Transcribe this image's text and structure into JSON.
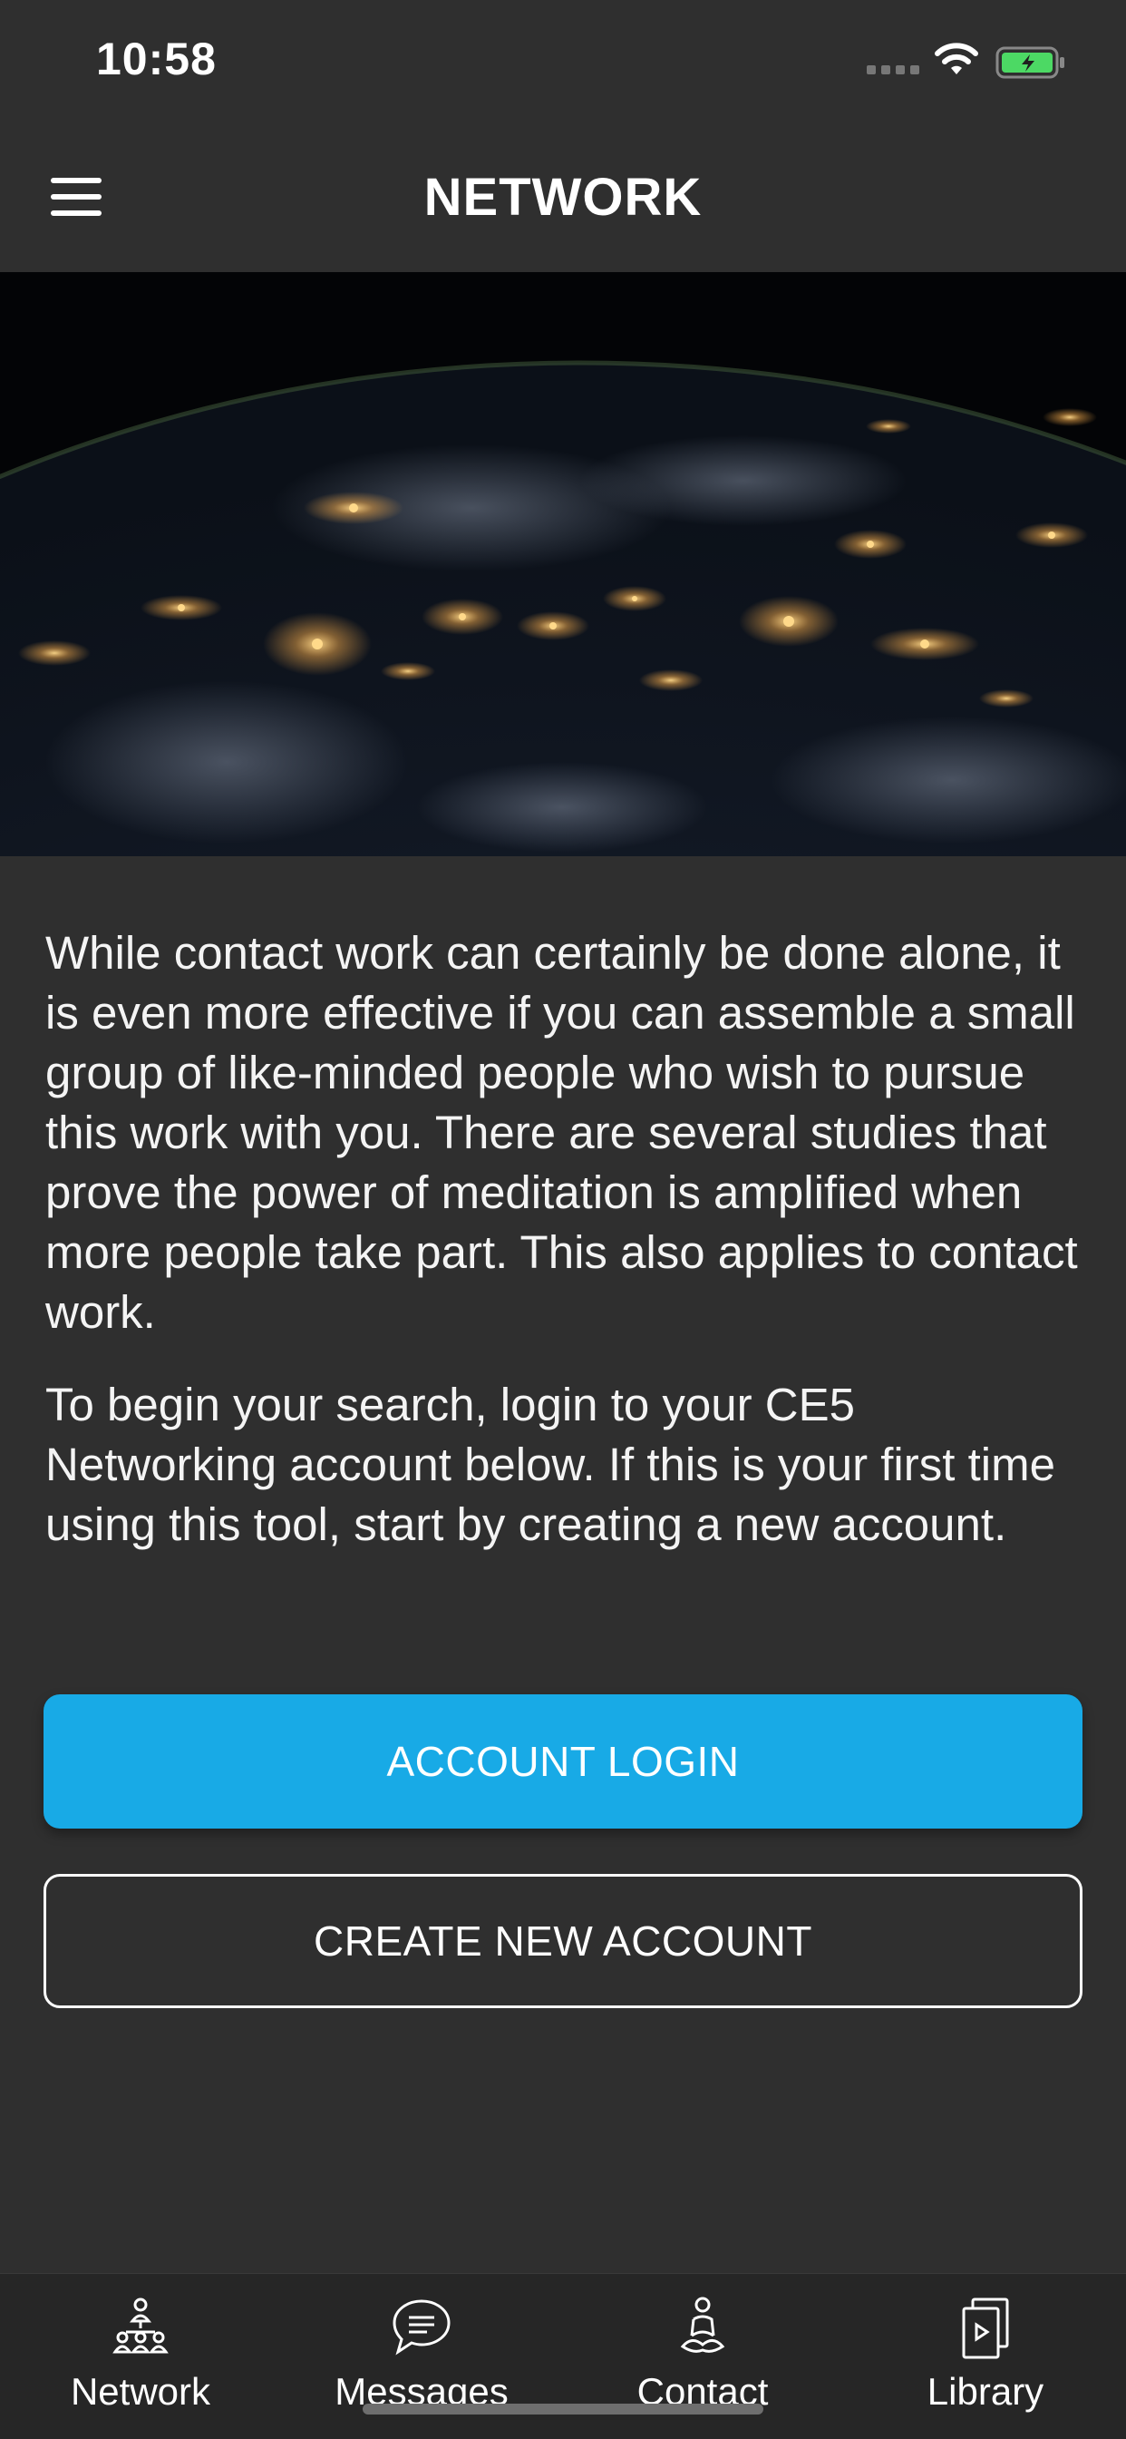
{
  "status_bar": {
    "time": "10:58",
    "wifi_icon": "wifi-icon",
    "battery_icon": "battery-charging-icon",
    "battery_color": "#4cd964"
  },
  "header": {
    "title": "NETWORK",
    "menu_icon": "hamburger-menu-icon"
  },
  "hero": {
    "image": "earth-at-night-from-space"
  },
  "content": {
    "paragraph_1": "While contact work can certainly be done alone, it is even more effective if you can assemble a small group of like-minded people who wish to pursue this work with you. There are several studies that prove the power of meditation is amplified when more people take part. This also applies to contact work.",
    "paragraph_2": "To begin your search, login to your CE5 Networking account below. If this is your first time using this tool, start by creating a new account."
  },
  "buttons": {
    "login_label": "ACCOUNT LOGIN",
    "create_label": "CREATE NEW ACCOUNT",
    "accent_color": "#18aae6"
  },
  "tab_bar": {
    "tabs": [
      {
        "label": "Network",
        "icon": "network-people-icon"
      },
      {
        "label": "Messages",
        "icon": "chat-bubble-icon"
      },
      {
        "label": "Contact",
        "icon": "meditation-person-icon"
      },
      {
        "label": "Library",
        "icon": "video-library-icon"
      }
    ]
  }
}
